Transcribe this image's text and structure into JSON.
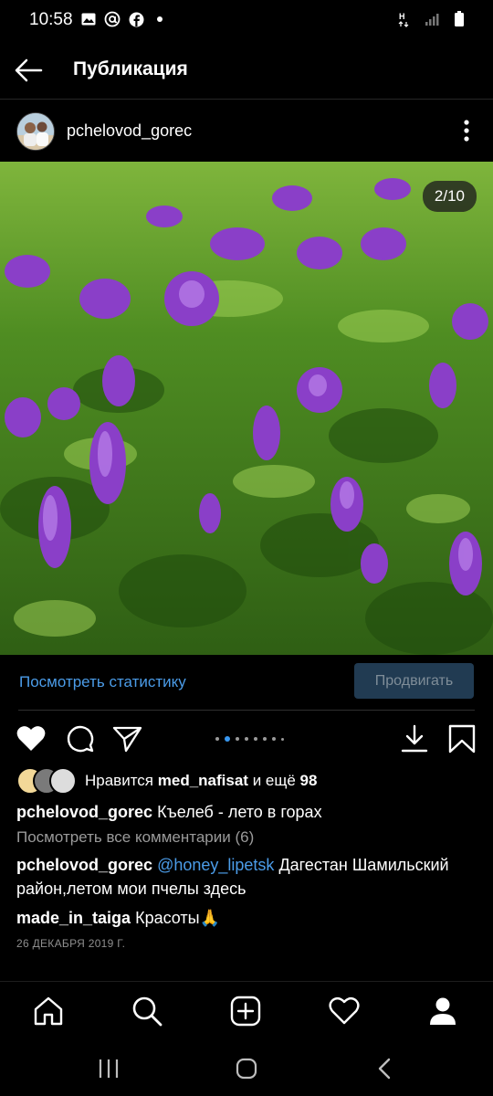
{
  "status_bar": {
    "time": "10:58",
    "left_icons": [
      "gallery-icon",
      "at-sign-icon",
      "facebook-icon",
      "dot-icon"
    ],
    "right_icons": [
      "network-h-icon",
      "signal-icon",
      "battery-icon"
    ]
  },
  "header": {
    "title": "Публикация",
    "back_icon": "back-arrow-icon"
  },
  "post": {
    "username": "pchelovod_gorec",
    "slide_counter": "2/10",
    "total_slides": 10,
    "current_slide": 2,
    "stats_link": "Посмотреть статистику",
    "promote_label": "Продвигать",
    "likes": {
      "prefix": "Нравится",
      "user": "med_nafisat",
      "middle": "и ещё",
      "count": "98"
    },
    "caption": {
      "user": "pchelovod_gorec",
      "text": "Къелеб - лето в горах"
    },
    "view_comments": "Посмотреть все комментарии (6)",
    "comments": [
      {
        "user": "pchelovod_gorec",
        "mention": "@honey_lipetsk",
        "text": "Дагестан Шамильский район,летом мои пчелы  здесь"
      },
      {
        "user": "made_in_taiga",
        "text": "Красоты🙏"
      }
    ],
    "date": "26 ДЕКАБРЯ 2019 Г."
  },
  "bottom_nav": [
    "home-icon",
    "search-icon",
    "add-post-icon",
    "activity-heart-icon",
    "profile-icon"
  ],
  "system_nav": [
    "recents-icon",
    "home-button-icon",
    "back-icon"
  ],
  "colors": {
    "accent": "#3897f0",
    "link": "#4b9ce8",
    "promote_bg": "#213b52",
    "background": "#000000"
  }
}
